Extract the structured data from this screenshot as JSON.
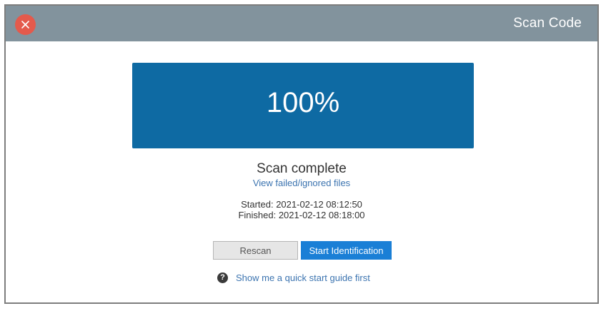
{
  "window": {
    "title": "Scan Code",
    "close_icon": "close-icon"
  },
  "progress": {
    "percent_text": "100%",
    "fraction": 1.0
  },
  "status": {
    "text": "Scan complete",
    "view_link": "View failed/ignored files"
  },
  "times": {
    "started": "Started: 2021-02-12 08:12:50",
    "finished": "Finished: 2021-02-12 08:18:00"
  },
  "buttons": {
    "rescan": "Rescan",
    "start_identification": "Start Identification"
  },
  "guide": {
    "icon": "help-icon",
    "label": "Show me a quick start guide first"
  },
  "colors": {
    "titlebar": "#82939d",
    "close": "#e45a4c",
    "progress_fill": "#0e6aa3",
    "primary_button": "#1a7fd6",
    "link": "#3c74b0"
  }
}
